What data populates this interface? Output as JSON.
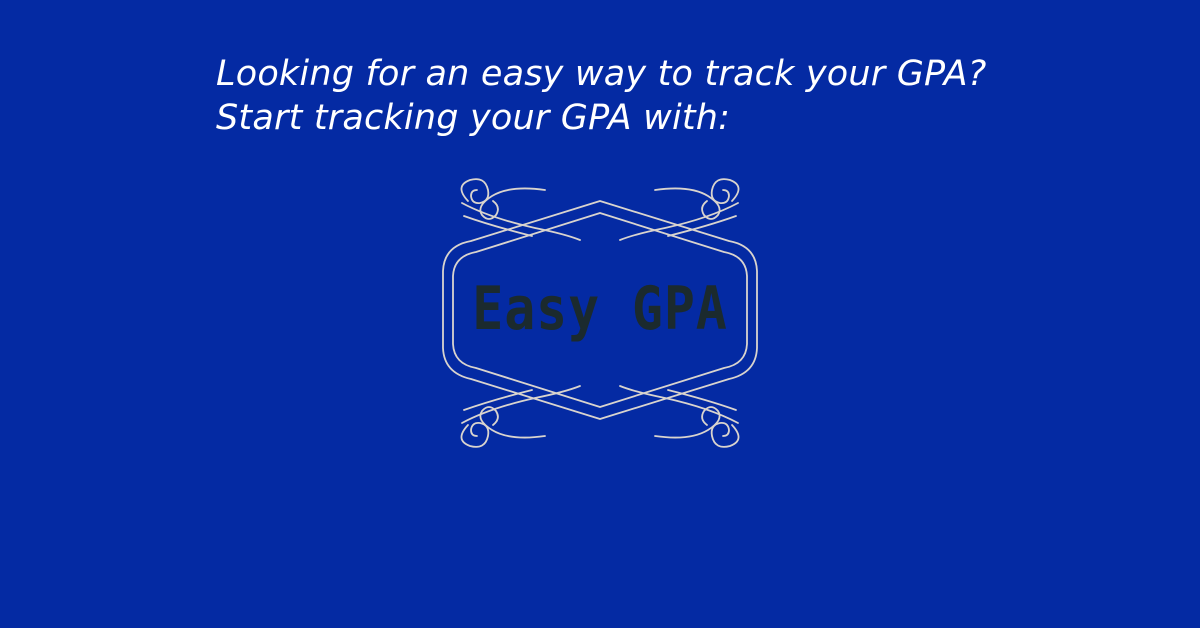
{
  "headline": {
    "line1": "Looking for an easy way to track your GPA?",
    "line2": "Start tracking your GPA with:"
  },
  "logo": {
    "text": "Easy GPA",
    "frame_icon": "ornamental-frame-icon"
  },
  "colors": {
    "background": "#042aa3",
    "headline_text": "#ffffff",
    "logo_text": "#1b2a2e",
    "frame_stroke": "#d9d4ce"
  }
}
